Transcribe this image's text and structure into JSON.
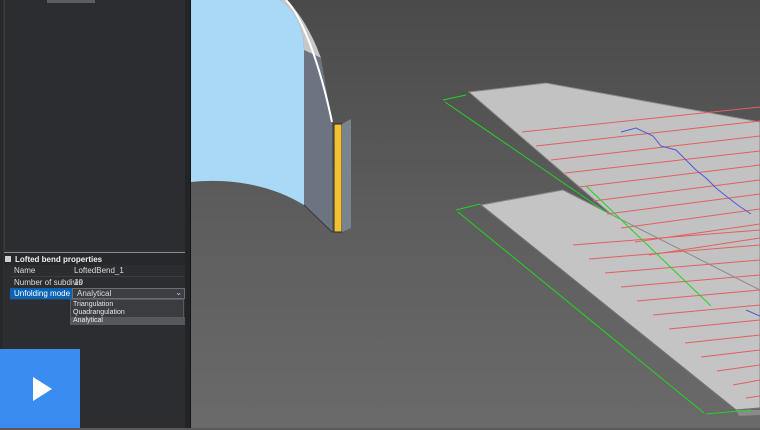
{
  "properties_panel": {
    "title": "Lofted bend properties",
    "rows": [
      {
        "key": "Name",
        "value": "LoftedBend_1"
      },
      {
        "key": "Number of subdivis",
        "value": "10"
      },
      {
        "key": "Unfolding mode",
        "value": "Analytical"
      }
    ],
    "dropdown_options": [
      "Triangulation",
      "Quadrangulation",
      "Analytical"
    ],
    "selected_option": "Analytical"
  },
  "video": {
    "play_icon": "play-icon"
  },
  "colors": {
    "accent_blue": "#3a8df0",
    "selection_blue": "#0b63b6",
    "bend_line": "#e05a5a",
    "dimension_green": "#1fd11f",
    "sheet_gray": "#c4c4c4",
    "face_blue": "#a6d8f8",
    "edge_yellow": "#f1c232"
  }
}
